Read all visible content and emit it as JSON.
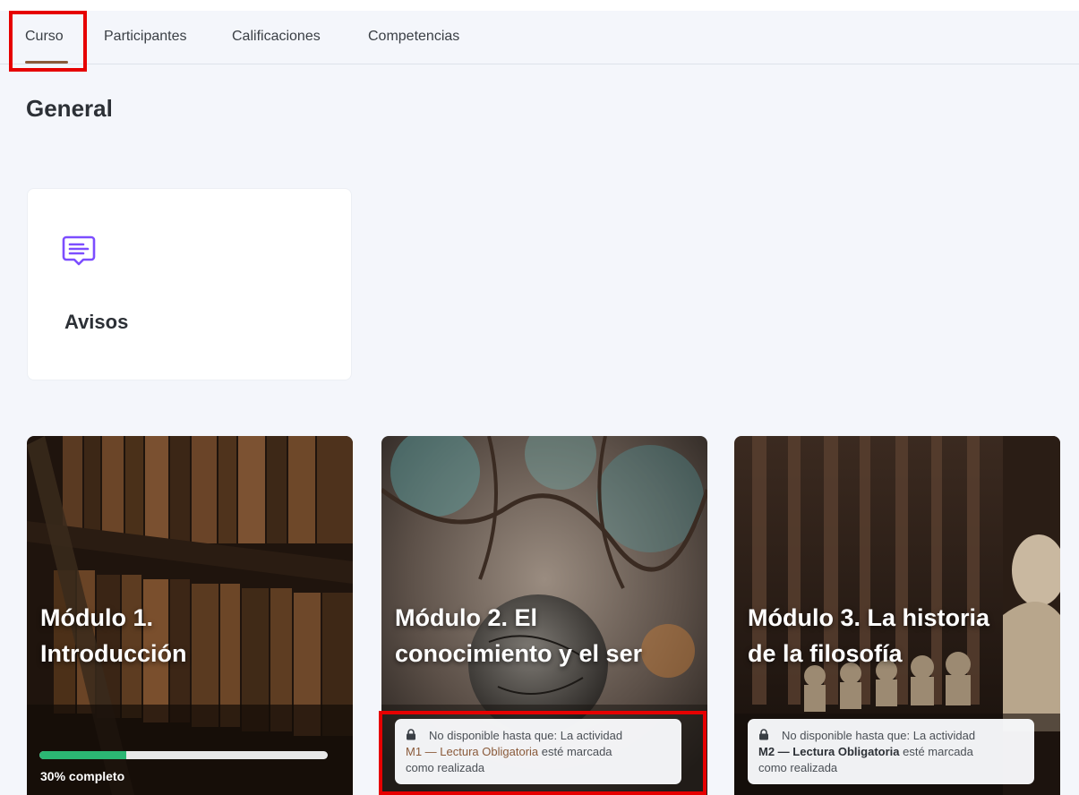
{
  "tabs": [
    {
      "label": "Curso",
      "active": true
    },
    {
      "label": "Participantes",
      "active": false
    },
    {
      "label": "Calificaciones",
      "active": false
    },
    {
      "label": "Competencias",
      "active": false
    }
  ],
  "section": {
    "title": "General"
  },
  "avisos": {
    "label": "Avisos",
    "icon": "forum-icon"
  },
  "modules": [
    {
      "title_line1": "Módulo 1.",
      "title_line2": "Introducción",
      "progress": 0.3,
      "progress_label": "30% completo"
    },
    {
      "title_line1": "Módulo 2. El",
      "title_line2": "conocimiento y el ser",
      "restriction": {
        "prefix": "No disponible hasta que: La actividad",
        "activity_code": "M1 —",
        "activity_name": "Lectura Obligatoria",
        "suffix": "esté marcada",
        "suffix2": "como realizada"
      }
    },
    {
      "title_line1": "Módulo 3. La historia",
      "title_line2": "de la filosofía",
      "restriction": {
        "prefix": "No disponible hasta que: La actividad",
        "activity_code": "M2 —",
        "activity_name": "Lectura Obligatoria",
        "suffix": "esté marcada",
        "suffix2": "como realizada"
      }
    }
  ],
  "colors": {
    "accent": "#8a5a3a",
    "progress": "#2bb673",
    "icon": "#7c4dff",
    "highlight": "#e60000"
  }
}
